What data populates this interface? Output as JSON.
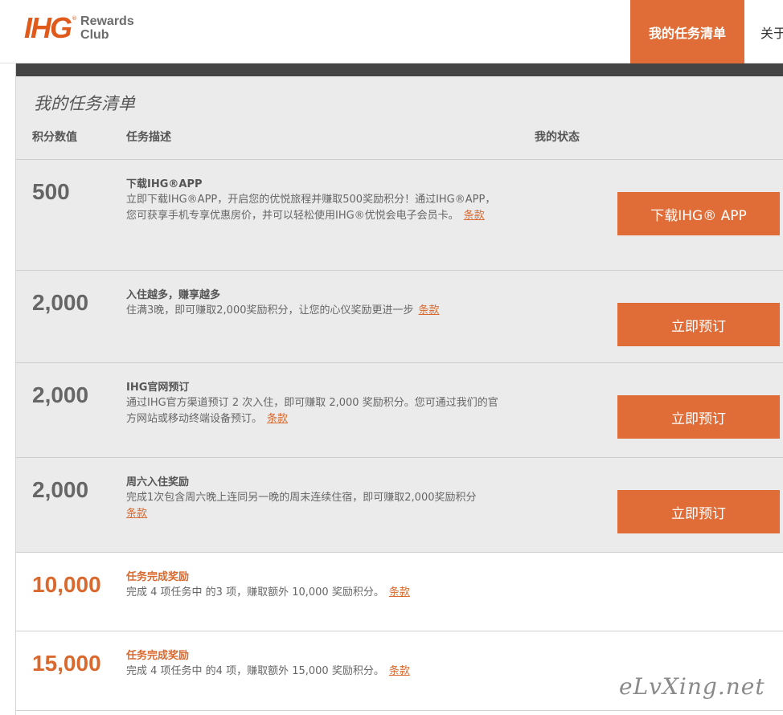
{
  "header": {
    "logo_mark": "IHG",
    "logo_reg": "®",
    "logo_line1": "Rewards",
    "logo_line2": "Club",
    "nav": [
      "我的任务清单",
      "关于"
    ]
  },
  "panel": {
    "title": "我的任务清单",
    "columns": {
      "points": "积分数值",
      "description": "任务描述",
      "status": "我的状态"
    }
  },
  "tasks": [
    {
      "points": "500",
      "title": "下载IHG®APP",
      "text": "立即下载IHG®APP，开启您的优悦旅程并赚取500奖励积分！通过IHG®APP，您可获享手机专享优惠房价，并可以轻松使用IHG®优悦会电子会员卡。",
      "terms": "条款",
      "button": "下载IHG® APP"
    },
    {
      "points": "2,000",
      "title": "入住越多，赚享越多",
      "text": "住满3晚，即可赚取2,000奖励积分，让您的心仪奖励更进一步",
      "terms": "条款",
      "button": "立即预订"
    },
    {
      "points": "2,000",
      "title": "IHG官网预订",
      "text": "通过IHG官方渠道预订 2 次入住，即可赚取 2,000 奖励积分。您可通过我们的官方网站或移动终端设备预订。",
      "terms": "条款",
      "button": "立即预订"
    },
    {
      "points": "2,000",
      "title": "周六入住奖励",
      "text": "完成1次包含周六晚上连同另一晚的周末连续住宿，即可赚取2,000奖励积分",
      "terms": "条款",
      "button": "立即预订"
    },
    {
      "points": "10,000",
      "title": "任务完成奖励",
      "text": "完成 4 项任务中 的3 项，赚取额外 10,000 奖励积分。",
      "terms": "条款"
    },
    {
      "points": "15,000",
      "title": "任务完成奖励",
      "text": "完成 4 项任务中 的4 项，赚取额外 15,000 奖励积分。",
      "terms": "条款"
    }
  ],
  "watermark": "eLvXing.net",
  "colors": {
    "accent": "#e06d37",
    "bar": "#444444",
    "row_grey": "#ebebeb"
  }
}
